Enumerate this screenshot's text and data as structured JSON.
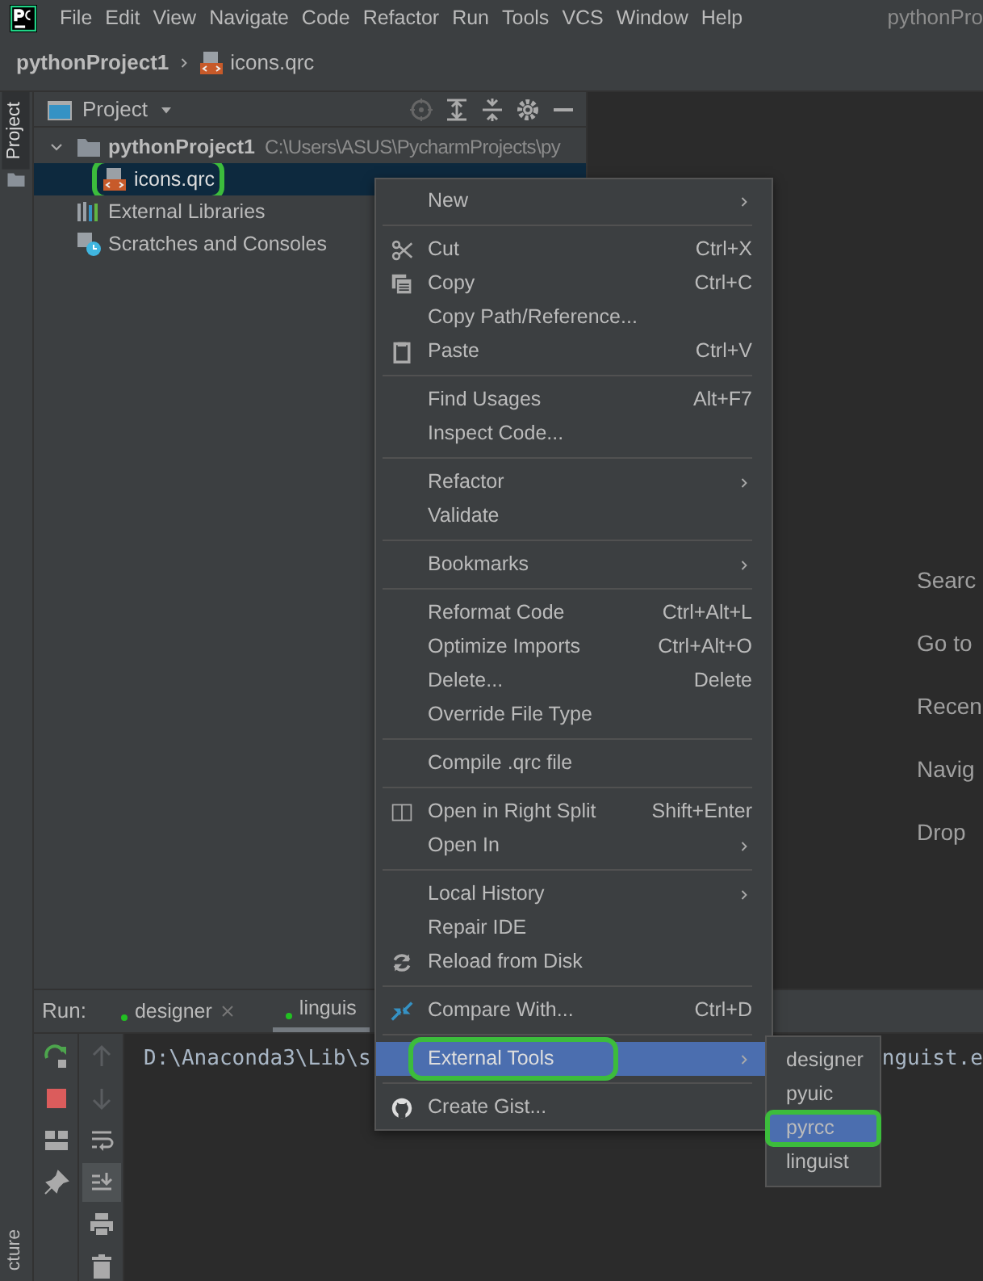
{
  "menu_bar": {
    "items": [
      "File",
      "Edit",
      "View",
      "Navigate",
      "Code",
      "Refactor",
      "Run",
      "Tools",
      "VCS",
      "Window",
      "Help"
    ],
    "title": "pythonPro"
  },
  "breadcrumb": [
    "pythonProject1",
    "icons.qrc"
  ],
  "left_strip": {
    "tabs": [
      {
        "label": "Project",
        "selected": true
      }
    ],
    "bottom_tab": "cture"
  },
  "project_panel": {
    "title": "Project",
    "tree": [
      {
        "label": "pythonProject1",
        "path": "C:\\Users\\ASUS\\PycharmProjects\\py",
        "kind": "folder",
        "expanded": true,
        "selected": false,
        "circled": false,
        "children": [
          {
            "label": "icons.qrc",
            "kind": "qrc",
            "selected": true,
            "circled": true
          }
        ]
      },
      {
        "label": "External Libraries",
        "kind": "libraries",
        "selected": false,
        "circled": false
      },
      {
        "label": "Scratches and Consoles",
        "kind": "scratches",
        "selected": false,
        "circled": false
      }
    ]
  },
  "editor_hints": [
    "Searc",
    "Go to",
    "Recen",
    "Navig",
    "Drop"
  ],
  "run_panel": {
    "title": "Run:",
    "tabs": [
      {
        "label": "designer",
        "closable": true,
        "selected": false
      },
      {
        "label": "linguis",
        "closable": false,
        "selected": true
      }
    ],
    "console_text": [
      "D:\\Anaconda3\\Lib\\s",
      "nguist.e"
    ]
  },
  "context_menu": [
    {
      "kind": "item",
      "label": "New",
      "submenu": true,
      "selected": false,
      "circled": false
    },
    {
      "kind": "separator"
    },
    {
      "kind": "item",
      "label": "Cut",
      "shortcut": "Ctrl+X",
      "selected": false,
      "circled": false
    },
    {
      "kind": "item",
      "label": "Copy",
      "shortcut": "Ctrl+C",
      "selected": false,
      "circled": false
    },
    {
      "kind": "item",
      "label": "Copy Path/Reference...",
      "selected": false,
      "circled": false
    },
    {
      "kind": "item",
      "label": "Paste",
      "shortcut": "Ctrl+V",
      "selected": false,
      "circled": false
    },
    {
      "kind": "separator"
    },
    {
      "kind": "item",
      "label": "Find Usages",
      "shortcut": "Alt+F7",
      "selected": false,
      "circled": false
    },
    {
      "kind": "item",
      "label": "Inspect Code...",
      "selected": false,
      "circled": false
    },
    {
      "kind": "separator"
    },
    {
      "kind": "item",
      "label": "Refactor",
      "submenu": true,
      "selected": false,
      "circled": false
    },
    {
      "kind": "item",
      "label": "Validate",
      "selected": false,
      "circled": false
    },
    {
      "kind": "separator"
    },
    {
      "kind": "item",
      "label": "Bookmarks",
      "submenu": true,
      "selected": false,
      "circled": false
    },
    {
      "kind": "separator"
    },
    {
      "kind": "item",
      "label": "Reformat Code",
      "shortcut": "Ctrl+Alt+L",
      "selected": false,
      "circled": false
    },
    {
      "kind": "item",
      "label": "Optimize Imports",
      "shortcut": "Ctrl+Alt+O",
      "selected": false,
      "circled": false
    },
    {
      "kind": "item",
      "label": "Delete...",
      "shortcut": "Delete",
      "selected": false,
      "circled": false
    },
    {
      "kind": "item",
      "label": "Override File Type",
      "selected": false,
      "circled": false
    },
    {
      "kind": "separator"
    },
    {
      "kind": "item",
      "label": "Compile .qrc file",
      "selected": false,
      "circled": false
    },
    {
      "kind": "separator"
    },
    {
      "kind": "item",
      "label": "Open in Right Split",
      "shortcut": "Shift+Enter",
      "selected": false,
      "circled": false
    },
    {
      "kind": "item",
      "label": "Open In",
      "submenu": true,
      "selected": false,
      "circled": false
    },
    {
      "kind": "separator"
    },
    {
      "kind": "item",
      "label": "Local History",
      "submenu": true,
      "selected": false,
      "circled": false
    },
    {
      "kind": "item",
      "label": "Repair IDE",
      "selected": false,
      "circled": false
    },
    {
      "kind": "item",
      "label": "Reload from Disk",
      "selected": false,
      "circled": false
    },
    {
      "kind": "separator"
    },
    {
      "kind": "item",
      "label": "Compare With...",
      "shortcut": "Ctrl+D",
      "selected": false,
      "circled": false
    },
    {
      "kind": "separator"
    },
    {
      "kind": "item",
      "label": "External Tools",
      "submenu": true,
      "selected": true,
      "circled": true
    },
    {
      "kind": "separator"
    },
    {
      "kind": "item",
      "label": "Create Gist...",
      "selected": false,
      "circled": false
    }
  ],
  "submenu": [
    {
      "label": "designer",
      "selected": false,
      "circled": false
    },
    {
      "label": "pyuic",
      "selected": false,
      "circled": false
    },
    {
      "label": "pyrcc",
      "selected": true,
      "circled": true
    },
    {
      "label": "linguist",
      "selected": false,
      "circled": false
    }
  ]
}
